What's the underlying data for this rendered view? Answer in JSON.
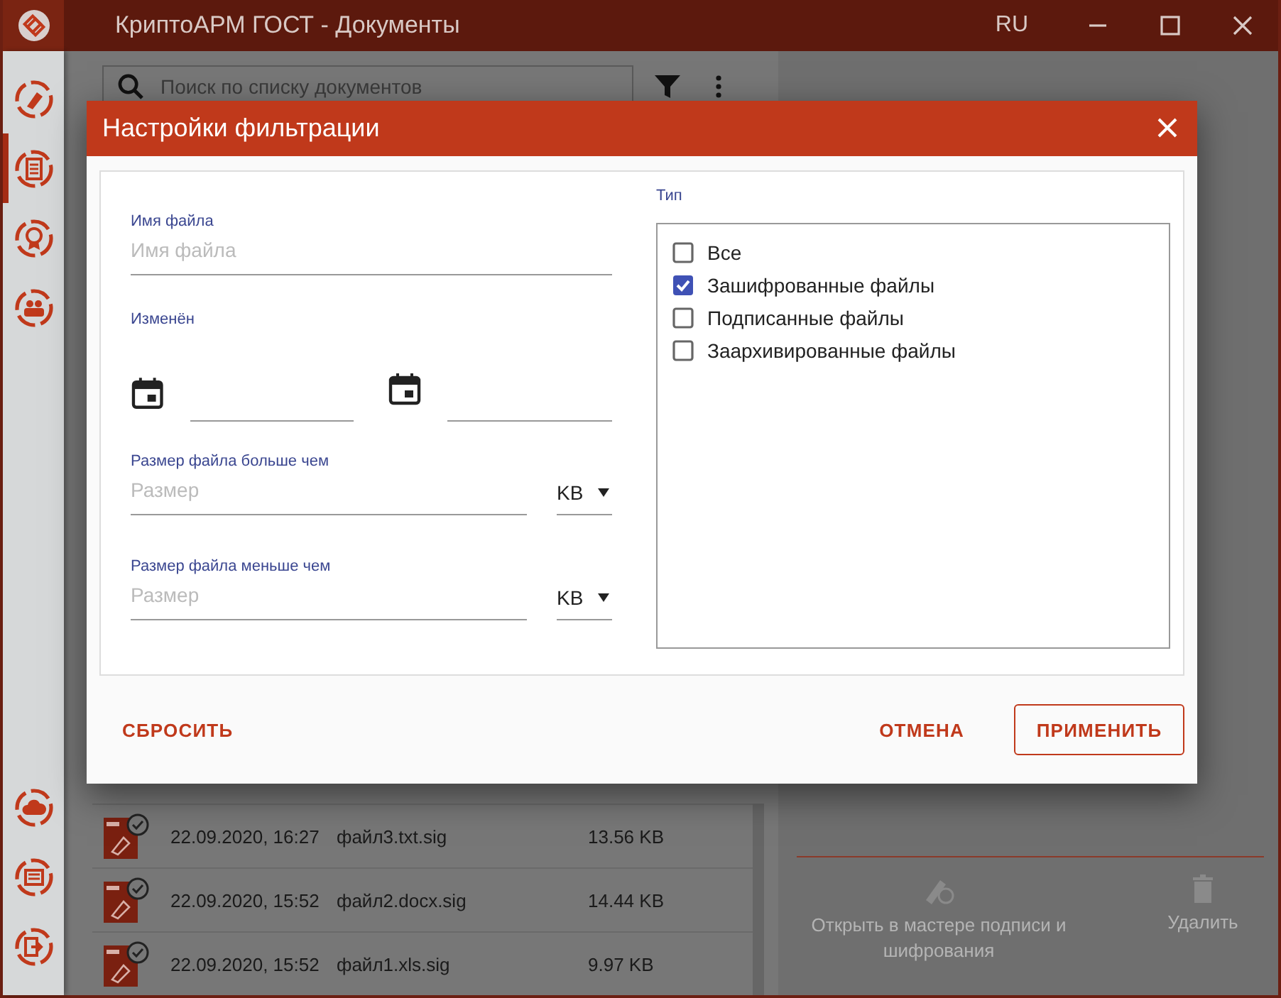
{
  "window": {
    "title": "КриптоАРМ ГОСТ - Документы",
    "language": "RU"
  },
  "sidebar": {
    "items": [
      {
        "kind": "sign",
        "selected": false
      },
      {
        "kind": "documents",
        "selected": true
      },
      {
        "kind": "certificates",
        "selected": false
      },
      {
        "kind": "contacts",
        "selected": false
      },
      {
        "kind": "cloud",
        "selected": false
      },
      {
        "kind": "journal",
        "selected": false
      },
      {
        "kind": "exit",
        "selected": false
      }
    ]
  },
  "search": {
    "placeholder": "Поиск по списку документов"
  },
  "documents": {
    "rows": [
      {
        "date": "22.09.2020, 16:27",
        "name": "файл3.txt.sig",
        "size": "13.56 KB"
      },
      {
        "date": "22.09.2020, 15:52",
        "name": "файл2.docx.sig",
        "size": "14.44 KB"
      },
      {
        "date": "22.09.2020, 15:52",
        "name": "файл1.xls.sig",
        "size": "9.97 KB"
      }
    ]
  },
  "actions": [
    {
      "kind": "open",
      "label": "Открыть в мастере подписи и шифрования"
    },
    {
      "kind": "delete",
      "label": "Удалить"
    }
  ],
  "dialog": {
    "title": "Настройки фильтрации",
    "file_name": {
      "label": "Имя файла",
      "placeholder": "Имя файла"
    },
    "modified": {
      "label": "Изменён"
    },
    "size_more": {
      "label": "Размер файла больше чем",
      "placeholder": "Размер",
      "unit": "KB"
    },
    "size_less": {
      "label": "Размер файла меньше чем",
      "placeholder": "Размер",
      "unit": "KB"
    },
    "type": {
      "label": "Тип",
      "options": [
        {
          "label": "Все",
          "checked": false
        },
        {
          "label": "Зашифрованные файлы",
          "checked": true
        },
        {
          "label": "Подписанные файлы",
          "checked": false
        },
        {
          "label": "Заархивированные файлы",
          "checked": false
        }
      ]
    },
    "buttons": {
      "reset": "СБРОСИТЬ",
      "cancel": "ОТМЕНА",
      "apply": "ПРИМЕНИТЬ"
    }
  }
}
